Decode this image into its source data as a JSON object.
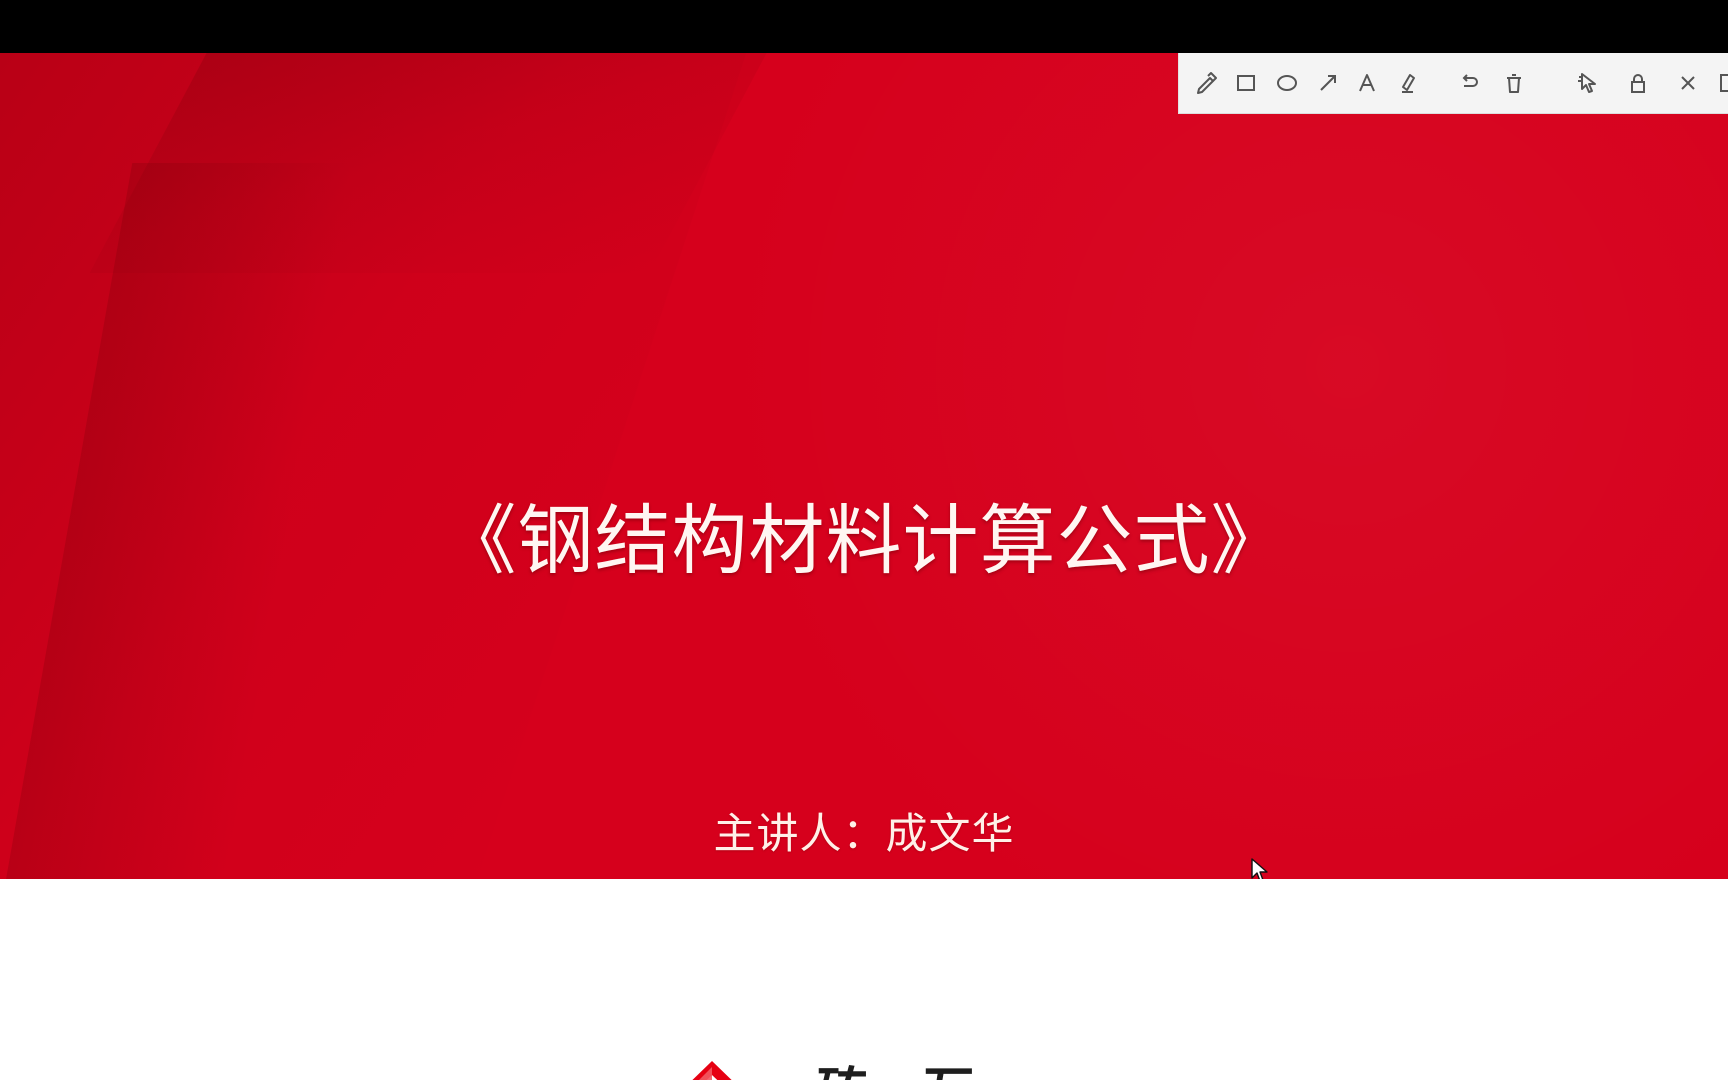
{
  "slide": {
    "title": "《钢结构材料计算公式》",
    "presenter": "主讲人：成文华",
    "brand_name": "一砖一瓦"
  },
  "colors": {
    "slide_red": "#d6001c",
    "slide_dark_wash": "#8a0010",
    "toolbar_background": "#f4f4f4",
    "toolbar_icon": "#555555",
    "brand_red": "#e60012",
    "brand_text": "#1e1e1e",
    "outer_background": "#000000",
    "page_white": "#ffffff"
  },
  "annotation_toolbar": {
    "icons": [
      "pen-icon",
      "rectangle-icon",
      "ellipse-icon",
      "arrow-icon",
      "text-icon",
      "marker-icon",
      "undo-icon",
      "trash-icon",
      "pointer-icon",
      "lock-icon",
      "close-icon",
      "toolbar-edge-icon"
    ]
  }
}
